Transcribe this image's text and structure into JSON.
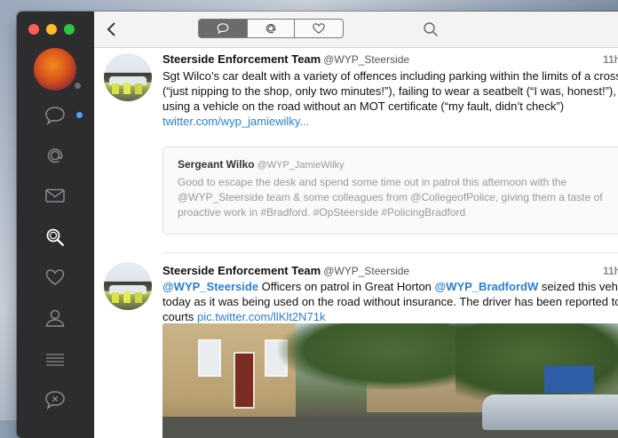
{
  "app": {
    "accent_color": "#2a7fd4",
    "unread_color": "#4aa3ff"
  },
  "sidebar": {
    "items": [
      {
        "id": "timeline",
        "icon": "speech-bubble-icon",
        "unread": true
      },
      {
        "id": "mentions",
        "icon": "at-sign-icon"
      },
      {
        "id": "messages",
        "icon": "envelope-icon"
      },
      {
        "id": "search",
        "icon": "magnifier-icon",
        "active": true
      },
      {
        "id": "likes",
        "icon": "heart-icon"
      },
      {
        "id": "profile",
        "icon": "person-icon"
      },
      {
        "id": "lists",
        "icon": "list-icon"
      },
      {
        "id": "muted",
        "icon": "muted-bubble-icon"
      }
    ]
  },
  "toolbar": {
    "back_icon": "chevron-left-icon",
    "segments": [
      {
        "icon": "speech-bubble-icon",
        "selected": true
      },
      {
        "icon": "at-sign-icon",
        "selected": false
      },
      {
        "icon": "heart-icon",
        "selected": false
      }
    ],
    "search_icon": "search-icon"
  },
  "tweets": [
    {
      "name": "Steerside Enforcement Team",
      "handle": "@WYP_Steerside",
      "time": "11h",
      "text_main": "Sgt Wilco’s car dealt with a variety of offences including parking within the limits of a crossing (“just nipping to the shop, only two minutes!”), failing to wear a seatbelt (“I was, honest!”), and using a vehicle on the road without an MOT certificate (“my fault, didn’t check”) ",
      "link": "twitter.com/wyp_jamiewilky...",
      "quote": {
        "name": "Sergeant Wilko",
        "handle": "@WYP_JamieWilky",
        "text": "Good to escape the desk and spend some time out in patrol this afternoon with the @WYP_Steerside team & some colleagues from @CollegeofPolice, giving them a taste of proactive work in #Bradford. #OpSteerside #PolicingBradford"
      }
    },
    {
      "name": "Steerside Enforcement Team",
      "handle": "@WYP_Steerside",
      "time": "11h",
      "mention1": "@WYP_Steerside",
      "text_a": " Officers on patrol in Great Horton ",
      "mention2": "@WYP_BradfordW",
      "text_b": " seized this vehicle today as it was being used on the road without insurance. The driver has been reported to the courts ",
      "link": "pic.twitter.com/llKlt2N71k"
    }
  ]
}
